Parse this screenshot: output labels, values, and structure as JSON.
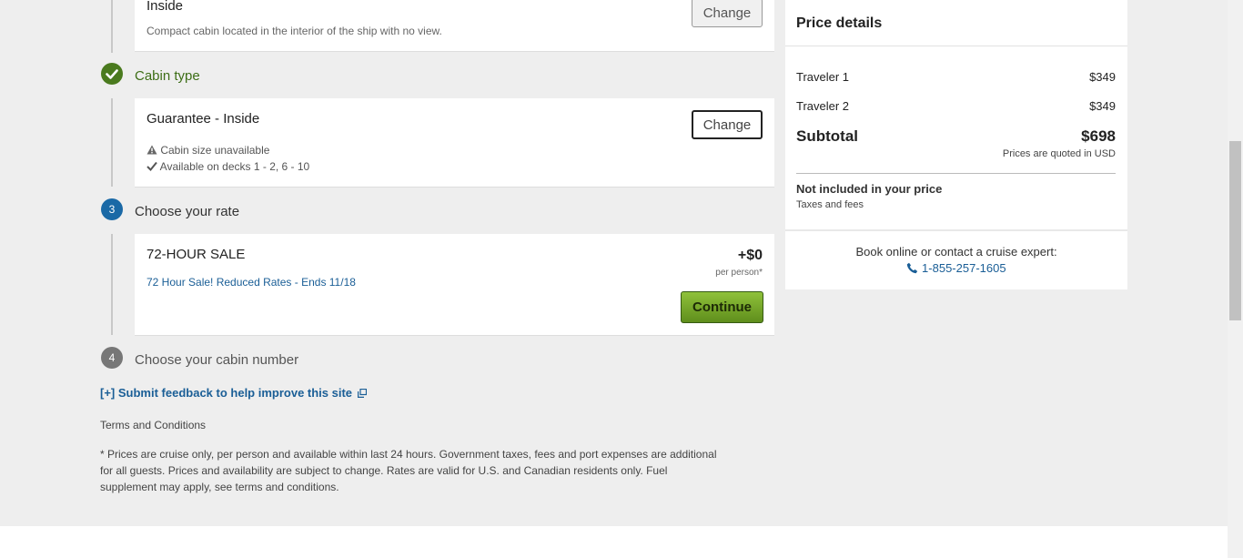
{
  "steps": {
    "room": {
      "title": "Inside",
      "description": "Compact cabin located in the interior of the ship with no view.",
      "change_label": "Change"
    },
    "cabin_type": {
      "label": "Cabin type",
      "title": "Guarantee - Inside",
      "notes": [
        {
          "icon": "warning-icon",
          "text": "Cabin size unavailable"
        },
        {
          "icon": "check-icon",
          "text": "Available on decks 1 - 2, 6 - 10"
        }
      ],
      "change_label": "Change"
    },
    "rate": {
      "number": "3",
      "label": "Choose your rate",
      "rate_name": "72-HOUR SALE",
      "promo_link": "72 Hour Sale! Reduced Rates - Ends 11/18",
      "price_delta": "+$0",
      "price_note": "per person*",
      "continue_label": "Continue"
    },
    "cabin_number": {
      "number": "4",
      "label": "Choose your cabin number"
    }
  },
  "feedback": {
    "prefix": "[+]",
    "label": "Submit feedback to help improve this site"
  },
  "terms": {
    "heading": "Terms and Conditions",
    "lines": [
      "* Prices are cruise only, per person and available within last 24 hours. Government taxes, fees and port expenses are additional",
      "for all guests. Prices and availability are subject to change. Rates are valid for U.S. and Canadian residents only. Fuel",
      "supplement may apply, see terms and conditions."
    ]
  },
  "price_details": {
    "title": "Price details",
    "travelers": [
      {
        "label": "Traveler 1",
        "price": "$349"
      },
      {
        "label": "Traveler 2",
        "price": "$349"
      }
    ],
    "subtotal_label": "Subtotal",
    "subtotal_value": "$698",
    "currency_note": "Prices are quoted in USD",
    "not_included_title": "Not included in your price",
    "not_included_items": "Taxes and fees",
    "contact_text": "Book online or contact a cruise expert:",
    "phone": "1-855-257-1605"
  },
  "colors": {
    "completed_step": "#4a7a1e",
    "active_step": "#1a69a6",
    "pending_step": "#777777",
    "link": "#1a5e96",
    "continue_button": "#6f9f24"
  }
}
